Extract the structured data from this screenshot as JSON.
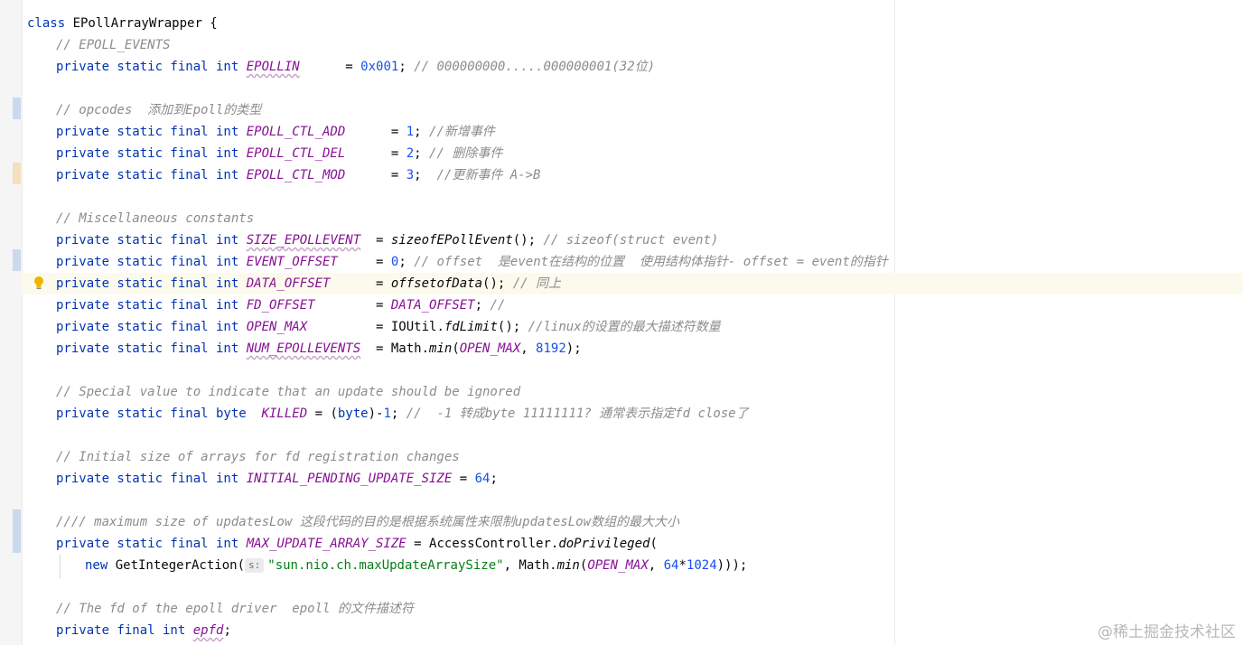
{
  "editor": {
    "lines": [
      {
        "indent": 0,
        "segments": [
          {
            "t": "class ",
            "c": "kw"
          },
          {
            "t": "EPollArrayWrapper {",
            "c": ""
          }
        ]
      },
      {
        "indent": 1,
        "segments": [
          {
            "t": "// EPOLL_EVENTS",
            "c": "cmt"
          }
        ]
      },
      {
        "indent": 1,
        "segments": [
          {
            "t": "private static final int ",
            "c": "kw"
          },
          {
            "t": "EPOLLIN",
            "c": "const",
            "wavy": true
          },
          {
            "t": "      = ",
            "c": ""
          },
          {
            "t": "0x001",
            "c": "num"
          },
          {
            "t": "; ",
            "c": ""
          },
          {
            "t": "// 000000000.....000000001(32位)",
            "c": "cmt"
          }
        ]
      },
      {
        "indent": 1,
        "segments": []
      },
      {
        "indent": 1,
        "segments": [
          {
            "t": "// opcodes  添加到Epoll的类型",
            "c": "cmt"
          }
        ]
      },
      {
        "indent": 1,
        "segments": [
          {
            "t": "private static final int ",
            "c": "kw"
          },
          {
            "t": "EPOLL_CTL_ADD",
            "c": "const"
          },
          {
            "t": "      = ",
            "c": ""
          },
          {
            "t": "1",
            "c": "num"
          },
          {
            "t": "; ",
            "c": ""
          },
          {
            "t": "//新增事件",
            "c": "cmt"
          }
        ]
      },
      {
        "indent": 1,
        "segments": [
          {
            "t": "private static final int ",
            "c": "kw"
          },
          {
            "t": "EPOLL_CTL_DEL",
            "c": "const"
          },
          {
            "t": "      = ",
            "c": ""
          },
          {
            "t": "2",
            "c": "num"
          },
          {
            "t": "; ",
            "c": ""
          },
          {
            "t": "// 删除事件",
            "c": "cmt"
          }
        ]
      },
      {
        "indent": 1,
        "segments": [
          {
            "t": "private static final int ",
            "c": "kw"
          },
          {
            "t": "EPOLL_CTL_MOD",
            "c": "const"
          },
          {
            "t": "      = ",
            "c": ""
          },
          {
            "t": "3",
            "c": "num"
          },
          {
            "t": ";  ",
            "c": ""
          },
          {
            "t": "//更新事件 A->B",
            "c": "cmt"
          }
        ]
      },
      {
        "indent": 1,
        "segments": []
      },
      {
        "indent": 1,
        "segments": [
          {
            "t": "// Miscellaneous constants",
            "c": "cmt"
          }
        ]
      },
      {
        "indent": 1,
        "segments": [
          {
            "t": "private static final int ",
            "c": "kw"
          },
          {
            "t": "SIZE_EPOLLEVENT",
            "c": "const",
            "wavy": true
          },
          {
            "t": "  = ",
            "c": ""
          },
          {
            "t": "sizeofEPollEvent",
            "c": "mcall"
          },
          {
            "t": "(); ",
            "c": ""
          },
          {
            "t": "// sizeof(struct event)",
            "c": "cmt"
          }
        ]
      },
      {
        "indent": 1,
        "segments": [
          {
            "t": "private static final int ",
            "c": "kw"
          },
          {
            "t": "EVENT_OFFSET",
            "c": "const"
          },
          {
            "t": "     = ",
            "c": ""
          },
          {
            "t": "0",
            "c": "num"
          },
          {
            "t": "; ",
            "c": ""
          },
          {
            "t": "// offset  是event在结构的位置  使用结构体指针- offset = event的指针",
            "c": "cmt"
          }
        ]
      },
      {
        "indent": 1,
        "segments": [
          {
            "t": "private static final int ",
            "c": "kw"
          },
          {
            "t": "DATA_OFFSET",
            "c": "const"
          },
          {
            "t": "      = ",
            "c": ""
          },
          {
            "t": "offsetofData",
            "c": "mcall"
          },
          {
            "t": "(); ",
            "c": ""
          },
          {
            "t": "// 同上",
            "c": "cmt"
          }
        ]
      },
      {
        "indent": 1,
        "segments": [
          {
            "t": "private static final int ",
            "c": "kw"
          },
          {
            "t": "FD_OFFSET",
            "c": "const"
          },
          {
            "t": "        = ",
            "c": ""
          },
          {
            "t": "DATA_OFFSET",
            "c": "const"
          },
          {
            "t": "; ",
            "c": ""
          },
          {
            "t": "//",
            "c": "cmt"
          }
        ]
      },
      {
        "indent": 1,
        "segments": [
          {
            "t": "private static final int ",
            "c": "kw"
          },
          {
            "t": "OPEN_MAX",
            "c": "const"
          },
          {
            "t": "         = IOUtil.",
            "c": ""
          },
          {
            "t": "fdLimit",
            "c": "mcall"
          },
          {
            "t": "(); ",
            "c": ""
          },
          {
            "t": "//linux的设置的最大描述符数量",
            "c": "cmt"
          }
        ]
      },
      {
        "indent": 1,
        "segments": [
          {
            "t": "private static final int ",
            "c": "kw"
          },
          {
            "t": "NUM_EPOLLEVENTS",
            "c": "const",
            "wavy": true
          },
          {
            "t": "  = Math.",
            "c": ""
          },
          {
            "t": "min",
            "c": "mcall"
          },
          {
            "t": "(",
            "c": ""
          },
          {
            "t": "OPEN_MAX",
            "c": "const"
          },
          {
            "t": ", ",
            "c": ""
          },
          {
            "t": "8192",
            "c": "num"
          },
          {
            "t": ");",
            "c": ""
          }
        ]
      },
      {
        "indent": 1,
        "segments": []
      },
      {
        "indent": 1,
        "segments": [
          {
            "t": "// Special value to indicate that an update should be ignored",
            "c": "cmt"
          }
        ]
      },
      {
        "indent": 1,
        "segments": [
          {
            "t": "private static final byte  ",
            "c": "kw"
          },
          {
            "t": "KILLED",
            "c": "const"
          },
          {
            "t": " = (",
            "c": ""
          },
          {
            "t": "byte",
            "c": "kw"
          },
          {
            "t": ")-",
            "c": ""
          },
          {
            "t": "1",
            "c": "num"
          },
          {
            "t": "; ",
            "c": ""
          },
          {
            "t": "//  -1 转成byte 11111111? 通常表示指定fd close了",
            "c": "cmt"
          }
        ]
      },
      {
        "indent": 1,
        "segments": []
      },
      {
        "indent": 1,
        "segments": [
          {
            "t": "// Initial size of arrays for fd registration changes",
            "c": "cmt"
          }
        ]
      },
      {
        "indent": 1,
        "segments": [
          {
            "t": "private static final int ",
            "c": "kw"
          },
          {
            "t": "INITIAL_PENDING_UPDATE_SIZE",
            "c": "const"
          },
          {
            "t": " = ",
            "c": ""
          },
          {
            "t": "64",
            "c": "num"
          },
          {
            "t": ";",
            "c": ""
          }
        ]
      },
      {
        "indent": 1,
        "segments": []
      },
      {
        "indent": 1,
        "segments": [
          {
            "t": "//// maximum size of updatesLow 这段代码的目的是根据系统属性来限制updatesLow数组的最大大小",
            "c": "cmt"
          }
        ]
      },
      {
        "indent": 1,
        "segments": [
          {
            "t": "private static final int ",
            "c": "kw"
          },
          {
            "t": "MAX_UPDATE_ARRAY_SIZE",
            "c": "const"
          },
          {
            "t": " = AccessController.",
            "c": ""
          },
          {
            "t": "doPrivileged",
            "c": "mcall"
          },
          {
            "t": "(",
            "c": ""
          }
        ]
      },
      {
        "indent": 2,
        "segments": [
          {
            "t": "new ",
            "c": "kw"
          },
          {
            "t": "GetIntegerAction(",
            "c": ""
          },
          {
            "t": "s:",
            "c": "hint"
          },
          {
            "t": "\"sun.nio.ch.maxUpdateArraySize\"",
            "c": "str"
          },
          {
            "t": ", Math.",
            "c": ""
          },
          {
            "t": "min",
            "c": "mcall"
          },
          {
            "t": "(",
            "c": ""
          },
          {
            "t": "OPEN_MAX",
            "c": "const"
          },
          {
            "t": ", ",
            "c": ""
          },
          {
            "t": "64",
            "c": "num"
          },
          {
            "t": "*",
            "c": ""
          },
          {
            "t": "1024",
            "c": "num"
          },
          {
            "t": ")));",
            "c": ""
          }
        ]
      },
      {
        "indent": 1,
        "segments": []
      },
      {
        "indent": 1,
        "segments": [
          {
            "t": "// The fd of the epoll driver  epoll 的文件描述符",
            "c": "cmt"
          }
        ]
      },
      {
        "indent": 1,
        "segments": [
          {
            "t": "private final int ",
            "c": "kw"
          },
          {
            "t": "epfd",
            "c": "const",
            "wavy": true
          },
          {
            "t": ";",
            "c": ""
          }
        ]
      }
    ],
    "gutter_marks": [
      {
        "line": 4,
        "color": "#c9d9ee"
      },
      {
        "line": 7,
        "color": "#f4dfbe"
      },
      {
        "line": 11,
        "color": "#c9d9ee"
      },
      {
        "line": 23,
        "color": "#c9d9ee"
      },
      {
        "line": 24,
        "color": "#c9d9ee"
      }
    ],
    "caret_line": 12
  },
  "watermark": "@稀土掘金技术社区",
  "icons": {
    "intention": "lightbulb-icon"
  }
}
